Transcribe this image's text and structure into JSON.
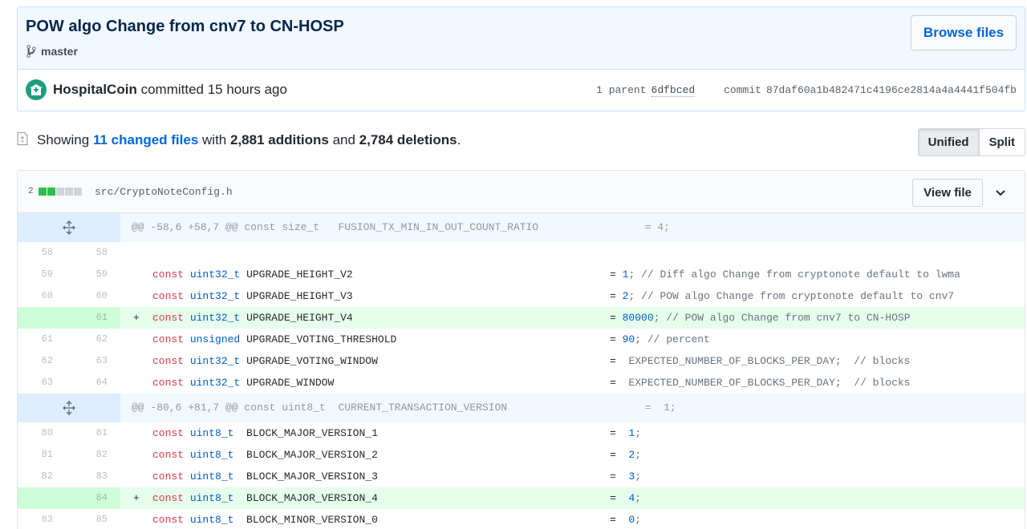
{
  "commit": {
    "title": "POW algo Change from cnv7 to CN-HOSP",
    "branch": "master",
    "browse_label": "Browse files",
    "author": "HospitalCoin",
    "committed_text": "committed 15 hours ago",
    "parent_label": "1 parent",
    "parent_sha": "6dfbced",
    "commit_label": "commit",
    "commit_sha": "87daf60a1b482471c4196ce2814a4a4441f504fb"
  },
  "toc": {
    "showing": "Showing",
    "changed_files": "11 changed files",
    "with": "with",
    "additions": "2,881 additions",
    "and": "and",
    "deletions": "2,784 deletions",
    "period": ".",
    "unified_label": "Unified",
    "split_label": "Split"
  },
  "file": {
    "change_count": "2",
    "path": "src/CryptoNoteConfig.h",
    "view_label": "View file"
  },
  "hunks": [
    "@@ -58,6 +58,7 @@ const size_t   FUSION_TX_MIN_IN_OUT_COUNT_RATIO                 = 4;",
    "@@ -80,6 +81,7 @@ const uint8_t  CURRENT_TRANSACTION_VERSION                      =  1;"
  ],
  "lines": [
    {
      "old": "58",
      "new": "58",
      "marker": "",
      "kw": "",
      "ty": "",
      "name": "",
      "eq": "",
      "val": "",
      "rest": ""
    },
    {
      "old": "59",
      "new": "59",
      "marker": "",
      "kw": "const",
      "ty": "uint32_t",
      "name": "UPGRADE_HEIGHT_V2",
      "eq": "=",
      "val": "1",
      "rest": "; // Diff algo Change from cryptonote default to lwma"
    },
    {
      "old": "60",
      "new": "60",
      "marker": "",
      "kw": "const",
      "ty": "uint32_t",
      "name": "UPGRADE_HEIGHT_V3",
      "eq": "=",
      "val": "2",
      "rest": "; // POW algo Change from cryptonote default to cnv7"
    },
    {
      "old": "",
      "new": "61",
      "marker": "+",
      "kw": "const",
      "ty": "uint32_t",
      "name": "UPGRADE_HEIGHT_V4",
      "eq": "=",
      "val": "80000",
      "rest": "; // POW algo Change from cnv7 to CN-HOSP"
    },
    {
      "old": "61",
      "new": "62",
      "marker": "",
      "kw": "const",
      "ty": "unsigned",
      "name": "UPGRADE_VOTING_THRESHOLD",
      "eq": "=",
      "val": "90",
      "rest": "; // percent"
    },
    {
      "old": "62",
      "new": "63",
      "marker": "",
      "kw": "const",
      "ty": "uint32_t",
      "name": "UPGRADE_VOTING_WINDOW",
      "eq": "=",
      "val": "",
      "rest": " EXPECTED_NUMBER_OF_BLOCKS_PER_DAY;  // blocks"
    },
    {
      "old": "63",
      "new": "64",
      "marker": "",
      "kw": "const",
      "ty": "uint32_t",
      "name": "UPGRADE_WINDOW",
      "eq": "=",
      "val": "",
      "rest": " EXPECTED_NUMBER_OF_BLOCKS_PER_DAY;  // blocks"
    }
  ],
  "lines2": [
    {
      "old": "80",
      "new": "81",
      "marker": "",
      "kw": "const",
      "ty": "uint8_t",
      "name": " BLOCK_MAJOR_VERSION_1",
      "eq": "=",
      "val": " 1",
      "rest": ";"
    },
    {
      "old": "81",
      "new": "82",
      "marker": "",
      "kw": "const",
      "ty": "uint8_t",
      "name": " BLOCK_MAJOR_VERSION_2",
      "eq": "=",
      "val": " 2",
      "rest": ";"
    },
    {
      "old": "82",
      "new": "83",
      "marker": "",
      "kw": "const",
      "ty": "uint8_t",
      "name": " BLOCK_MAJOR_VERSION_3",
      "eq": "=",
      "val": " 3",
      "rest": ";"
    },
    {
      "old": "",
      "new": "84",
      "marker": "+",
      "kw": "const",
      "ty": "uint8_t",
      "name": " BLOCK_MAJOR_VERSION_4",
      "eq": "=",
      "val": " 4",
      "rest": ";"
    },
    {
      "old": "83",
      "new": "85",
      "marker": "",
      "kw": "const",
      "ty": "uint8_t",
      "name": " BLOCK_MINOR_VERSION_0",
      "eq": "=",
      "val": " 0",
      "rest": ";"
    }
  ]
}
